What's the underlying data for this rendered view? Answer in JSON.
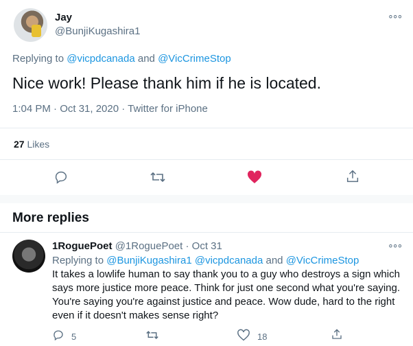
{
  "tweet": {
    "author_name": "Jay",
    "author_handle": "@BunjiKugashira1",
    "replying_to_label": "Replying to",
    "replying_mention_1": "@vicpdcanada",
    "replying_and": "and",
    "replying_mention_2": "@VicCrimeStop",
    "text": "Nice work! Please thank him if he is located.",
    "timestamp": "1:04 PM · Oct 31, 2020 · Twitter for iPhone",
    "likes_count": "27",
    "likes_label": "Likes",
    "more_glyph": "∘∘∘"
  },
  "section": {
    "more_replies_title": "More replies"
  },
  "reply": {
    "author_name": "1RoguePoet",
    "author_handle": "@1RoguePoet",
    "date": "· Oct 31",
    "replying_to_label": "Replying to",
    "mentions": [
      "@BunjiKugashira1",
      "@vicpdcanada",
      "and",
      "@VicCrimeStop"
    ],
    "text": "It takes a lowlife human to say thank you to a guy who destroys a sign which says more justice more peace. Think for just one second what you're saying. You're saying you're against justice and peace. Wow dude, hard to the right even if it doesn't makes sense right?",
    "reply_count": "5",
    "like_count": "18",
    "more_glyph": "∘∘∘"
  },
  "colors": {
    "link": "#1b95e0",
    "like_active": "#e0245e",
    "muted": "#5b7083"
  }
}
